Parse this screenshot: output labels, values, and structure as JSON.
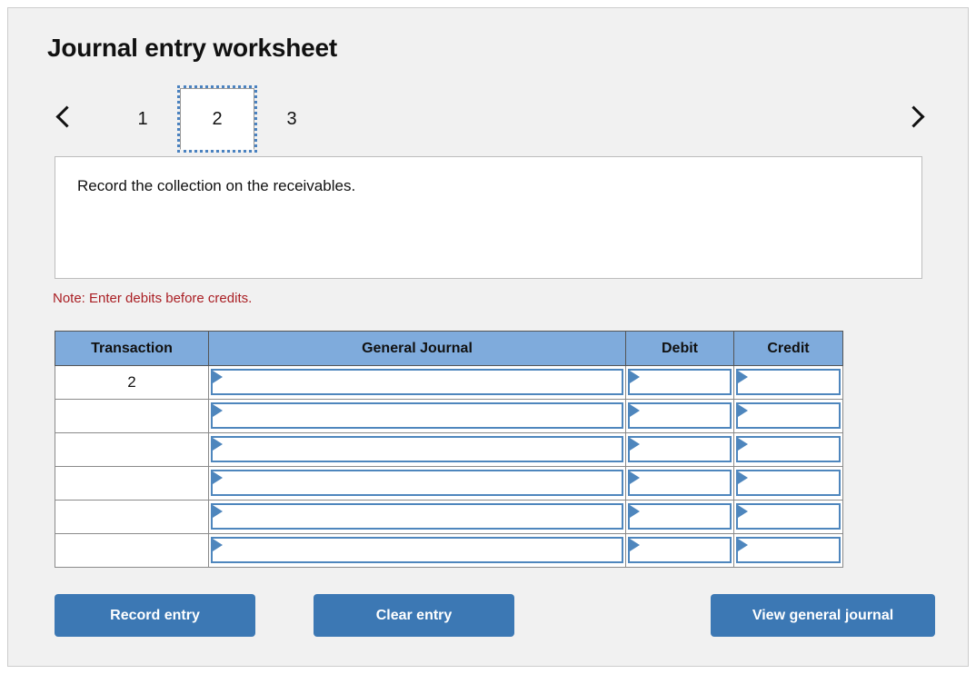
{
  "header": {
    "title": "Journal entry worksheet"
  },
  "navigation": {
    "prev_icon": "chevron-left-icon",
    "next_icon": "chevron-right-icon",
    "tabs": [
      {
        "label": "1",
        "active": false
      },
      {
        "label": "2",
        "active": true
      },
      {
        "label": "3",
        "active": false
      }
    ]
  },
  "description": {
    "text": "Record the collection on the receivables."
  },
  "note": {
    "text": "Note: Enter debits before credits."
  },
  "table": {
    "columns": [
      {
        "label": "Transaction"
      },
      {
        "label": "General Journal"
      },
      {
        "label": "Debit"
      },
      {
        "label": "Credit"
      }
    ],
    "rows": [
      {
        "transaction": "2",
        "general_journal": "",
        "debit": "",
        "credit": ""
      },
      {
        "transaction": "",
        "general_journal": "",
        "debit": "",
        "credit": ""
      },
      {
        "transaction": "",
        "general_journal": "",
        "debit": "",
        "credit": ""
      },
      {
        "transaction": "",
        "general_journal": "",
        "debit": "",
        "credit": ""
      },
      {
        "transaction": "",
        "general_journal": "",
        "debit": "",
        "credit": ""
      },
      {
        "transaction": "",
        "general_journal": "",
        "debit": "",
        "credit": ""
      }
    ]
  },
  "actions": {
    "record_label": "Record entry",
    "clear_label": "Clear entry",
    "view_label": "View general journal"
  },
  "colors": {
    "header_blue": "#7fabdc",
    "button_blue": "#3c78b4",
    "note_red": "#aa2025",
    "panel_bg": "#f1f1f1",
    "field_border_blue": "#4e86bd"
  }
}
